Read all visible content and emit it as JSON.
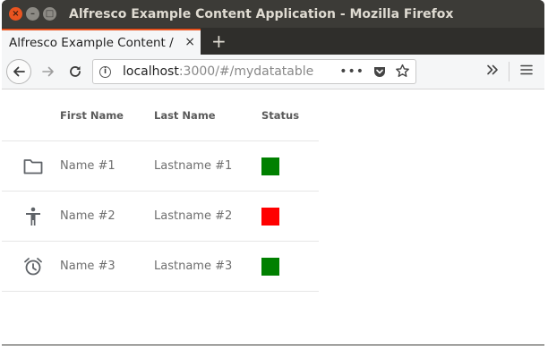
{
  "window": {
    "title": "Alfresco Example Content Application - Mozilla Firefox",
    "close_glyph": "×",
    "min_glyph": "–",
    "max_glyph": "□"
  },
  "tabs": [
    {
      "label": "Alfresco Example Content /",
      "close_glyph": "×"
    }
  ],
  "new_tab_glyph": "+",
  "url": {
    "host": "localhost",
    "path": ":3000/#/mydatatable"
  },
  "table": {
    "columns": [
      "First Name",
      "Last Name",
      "Status"
    ],
    "rows": [
      {
        "icon": "folder-icon",
        "first": "Name #1",
        "last": "Lastname #1",
        "status_color": "#008000"
      },
      {
        "icon": "accessibility-icon",
        "first": "Name #2",
        "last": "Lastname #2",
        "status_color": "#ff0000"
      },
      {
        "icon": "alarm-icon",
        "first": "Name #3",
        "last": "Lastname #3",
        "status_color": "#008000"
      }
    ]
  },
  "colors": {
    "accent": "#e95420",
    "titlebar": "#3c3b37",
    "status_green": "#008000",
    "status_red": "#ff0000"
  }
}
